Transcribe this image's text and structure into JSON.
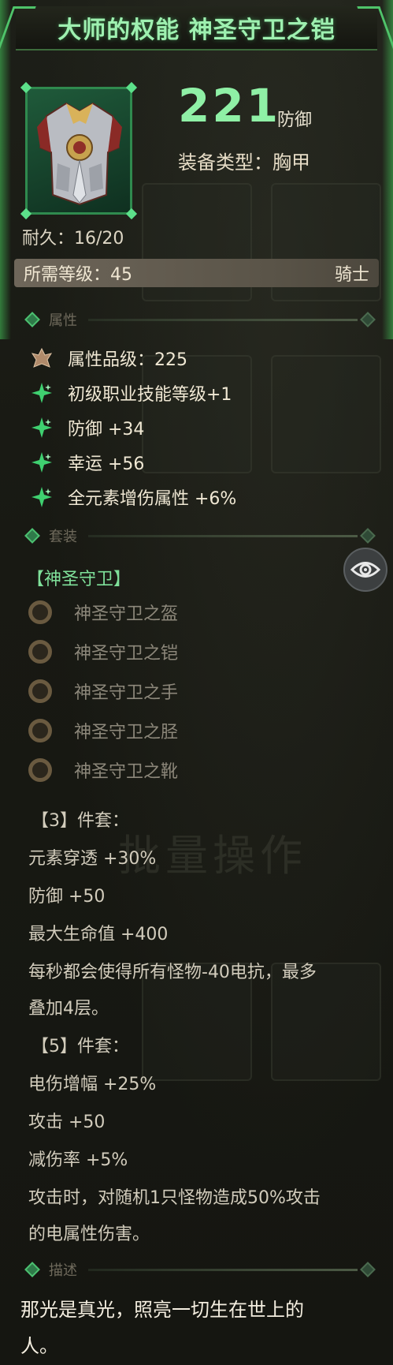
{
  "title": "大师的权能 神圣守卫之铠",
  "item": {
    "stat_value": "221",
    "stat_unit": "防御",
    "equip_type": "装备类型：胸甲",
    "durability": "耐久：16/20",
    "required_level": "所需等级：45",
    "class": "骑士"
  },
  "sections": {
    "attributes": "属性",
    "set": "套装",
    "description": "描述"
  },
  "attributes": [
    {
      "text": "属性品级：225",
      "icon": "grade-icon"
    },
    {
      "text": "初级职业技能等级+1",
      "icon": "sparkle-icon"
    },
    {
      "text": "防御 +34",
      "icon": "sparkle-icon"
    },
    {
      "text": "幸运 +56",
      "icon": "sparkle-icon"
    },
    {
      "text": "全元素增伤属性 +6%",
      "icon": "sparkle-icon"
    }
  ],
  "set": {
    "name": "【神圣守卫】",
    "pieces": [
      "神圣守卫之盔",
      "神圣守卫之铠",
      "神圣守卫之手",
      "神圣守卫之胫",
      "神圣守卫之靴"
    ],
    "bonus3_title": "【3】件套：",
    "bonus3": [
      "元素穿透 +30%",
      "防御 +50",
      "最大生命值 +400",
      "每秒都会使得所有怪物-40电抗，最多",
      "叠加4层。"
    ],
    "bonus5_title": "【5】件套：",
    "bonus5": [
      "电伤增幅 +25%",
      "攻击 +50",
      "减伤率 +5%",
      "攻击时，对随机1只怪物造成50%攻击",
      "的电属性伤害。"
    ]
  },
  "description": [
    "那光是真光，照亮一切生在世上的",
    "人。"
  ],
  "background_text": "批量操作",
  "colors": {
    "accent_green": "#8ff0a6",
    "set_green": "#7fe09a",
    "frame_green": "#2f8a4e",
    "background": "#171812"
  }
}
